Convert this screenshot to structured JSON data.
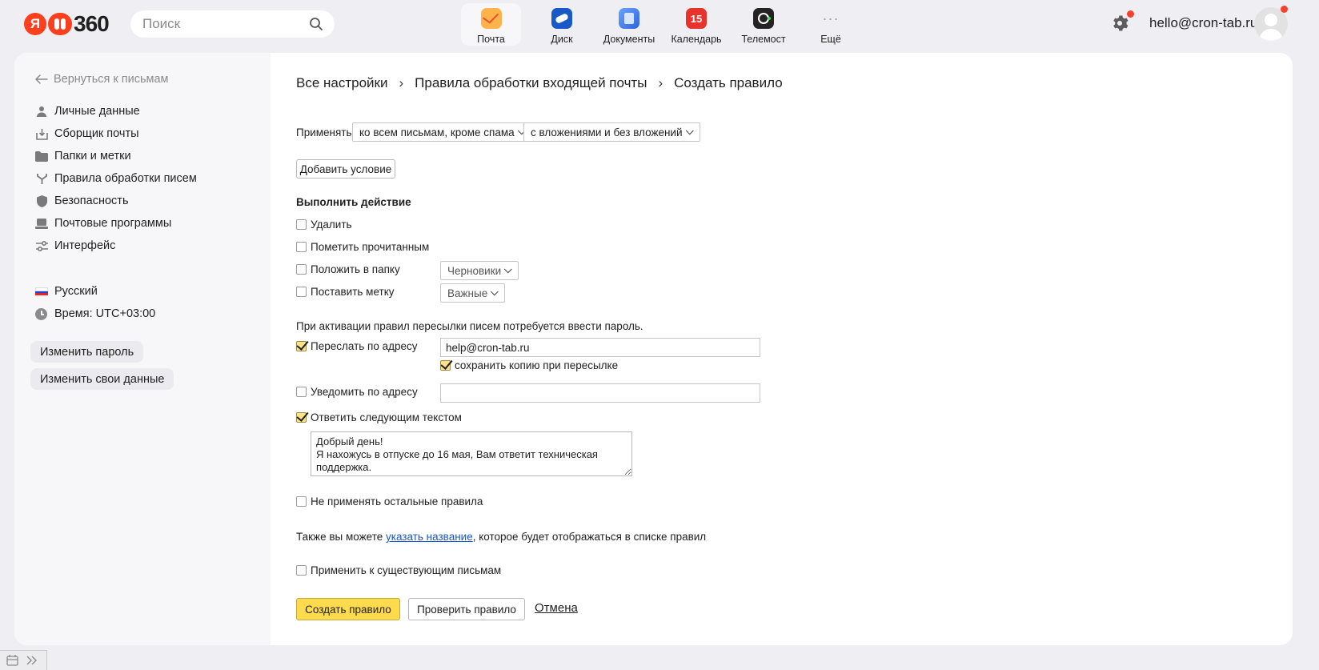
{
  "header": {
    "logo_text": "360",
    "search_placeholder": "Поиск",
    "services": [
      {
        "label": "Почта",
        "icon": "mail-icon"
      },
      {
        "label": "Диск",
        "icon": "disk-icon"
      },
      {
        "label": "Документы",
        "icon": "documents-icon"
      },
      {
        "label": "Календарь",
        "icon": "calendar-icon",
        "badge": "15"
      },
      {
        "label": "Телемост",
        "icon": "telemost-icon"
      },
      {
        "label": "Ещё",
        "icon": "more-icon",
        "glyph": "···"
      }
    ],
    "user_email": "hello@cron-tab.ru"
  },
  "sidebar": {
    "back_label": "Вернуться к письмам",
    "items": [
      {
        "label": "Личные данные",
        "icon": "person-icon"
      },
      {
        "label": "Сборщик почты",
        "icon": "inbox-download-icon"
      },
      {
        "label": "Папки и метки",
        "icon": "folder-icon"
      },
      {
        "label": "Правила обработки писем",
        "icon": "rules-icon"
      },
      {
        "label": "Безопасность",
        "icon": "shield-icon"
      },
      {
        "label": "Почтовые программы",
        "icon": "laptop-icon"
      },
      {
        "label": "Интерфейс",
        "icon": "sliders-icon"
      }
    ],
    "language": "Русский",
    "time": "Время: UTC+03:00",
    "change_password": "Изменить пароль",
    "change_data": "Изменить свои данные"
  },
  "main": {
    "breadcrumbs": [
      "Все настройки",
      "Правила обработки входящей почты",
      "Создать правило"
    ],
    "apply_label": "Применять",
    "apply_scope": "ко всем письмам, кроме спама",
    "apply_attachments": "с вложениями и без вложений",
    "add_condition": "Добавить условие",
    "action_heading": "Выполнить действие",
    "actions": {
      "delete": {
        "label": "Удалить",
        "checked": false
      },
      "mark_read": {
        "label": "Пометить прочитанным",
        "checked": false
      },
      "move_folder": {
        "label": "Положить в папку",
        "checked": false,
        "value": "Черновики"
      },
      "set_label": {
        "label": "Поставить метку",
        "checked": false,
        "value": "Важные"
      }
    },
    "password_notice": "При активации правил пересылки писем потребуется ввести пароль.",
    "forward": {
      "label": "Переслать по адресу",
      "checked": true,
      "value": "help@cron-tab.ru"
    },
    "keep_copy": {
      "label": "сохранить копию при пересылке",
      "checked": true
    },
    "notify": {
      "label": "Уведомить по адресу",
      "checked": false,
      "value": ""
    },
    "reply": {
      "label": "Ответить следующим текстом",
      "checked": true,
      "text": "Добрый день!\nЯ нахожусь в отпуске до 16 мая, Вам ответит техническая поддержка."
    },
    "stop_rules": {
      "label": "Не применять остальные правила",
      "checked": false
    },
    "name_hint_before": "Также вы можете ",
    "name_hint_link": "указать название",
    "name_hint_after": ", которое будет отображаться в списке правил",
    "apply_existing": {
      "label": "Применить к существующим письмам",
      "checked": false
    },
    "create_button": "Создать правило",
    "check_button": "Проверить правило",
    "cancel_link": "Отмена"
  },
  "colors": {
    "accent_yellow": "#ffdb4d",
    "brand_red": "#fc3f1d",
    "link_blue": "#1a56c4"
  }
}
